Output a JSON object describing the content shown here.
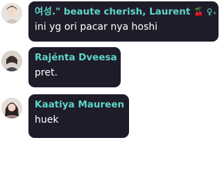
{
  "messages": [
    {
      "sender": "여성.\" beaute cherish, Laurent",
      "sender_decoration": "🍒 ♀︎₊",
      "text": "ini yg ori pacar nya hoshi",
      "avatar_icon": "user-avatar-icon"
    },
    {
      "sender": "Rajénta Dveesa",
      "text": "pret.",
      "avatar_icon": "user-avatar-icon"
    },
    {
      "sender": "Kaatiya Maureen",
      "text": "huek",
      "avatar_icon": "user-avatar-icon"
    }
  ],
  "colors": {
    "bubble": "#1f1c2a",
    "sender_name": "#5ed6c6",
    "message_text": "#ffffff",
    "background": "#ffffff"
  }
}
